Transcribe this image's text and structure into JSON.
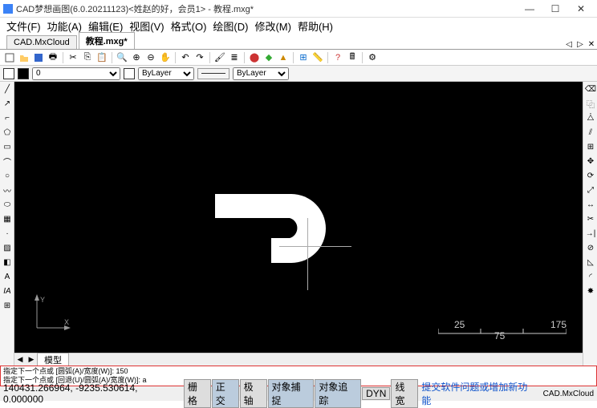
{
  "window": {
    "title": "CAD梦想画图(6.0.20211123)<姓赵的好，会员1> - 教程.mxg*"
  },
  "menu": {
    "items": [
      "文件(F)",
      "功能(A)",
      "编辑(E)",
      "视图(V)",
      "格式(O)",
      "绘图(D)",
      "修改(M)",
      "帮助(H)"
    ]
  },
  "tabs": {
    "items": [
      "CAD.MxCloud",
      "教程.mxg*"
    ],
    "active": 1
  },
  "props": {
    "layer": "0",
    "bylayer1": "ByLayer",
    "bylayer2": "ByLayer"
  },
  "model_tab": "模型",
  "command": {
    "line1": "指定下一个点或 [圆弧(A)/宽度(W)]: 150",
    "line2": "指定下一个点或 [回退(U)/圆弧(A)/宽度(W)]: a"
  },
  "status": {
    "coords": "140431.266964, -9235.530614, 0.000000",
    "buttons": [
      "栅格",
      "正交",
      "极轴",
      "对象捕捉",
      "对象追踪",
      "DYN",
      "线宽"
    ],
    "active_buttons": [
      1,
      3,
      4
    ],
    "link": "提交软件问题或增加新功能",
    "brand": "CAD.MxCloud"
  },
  "scale": {
    "a": "25",
    "b": "75",
    "c": "175"
  },
  "ucs": {
    "x": "X",
    "y": "Y"
  }
}
